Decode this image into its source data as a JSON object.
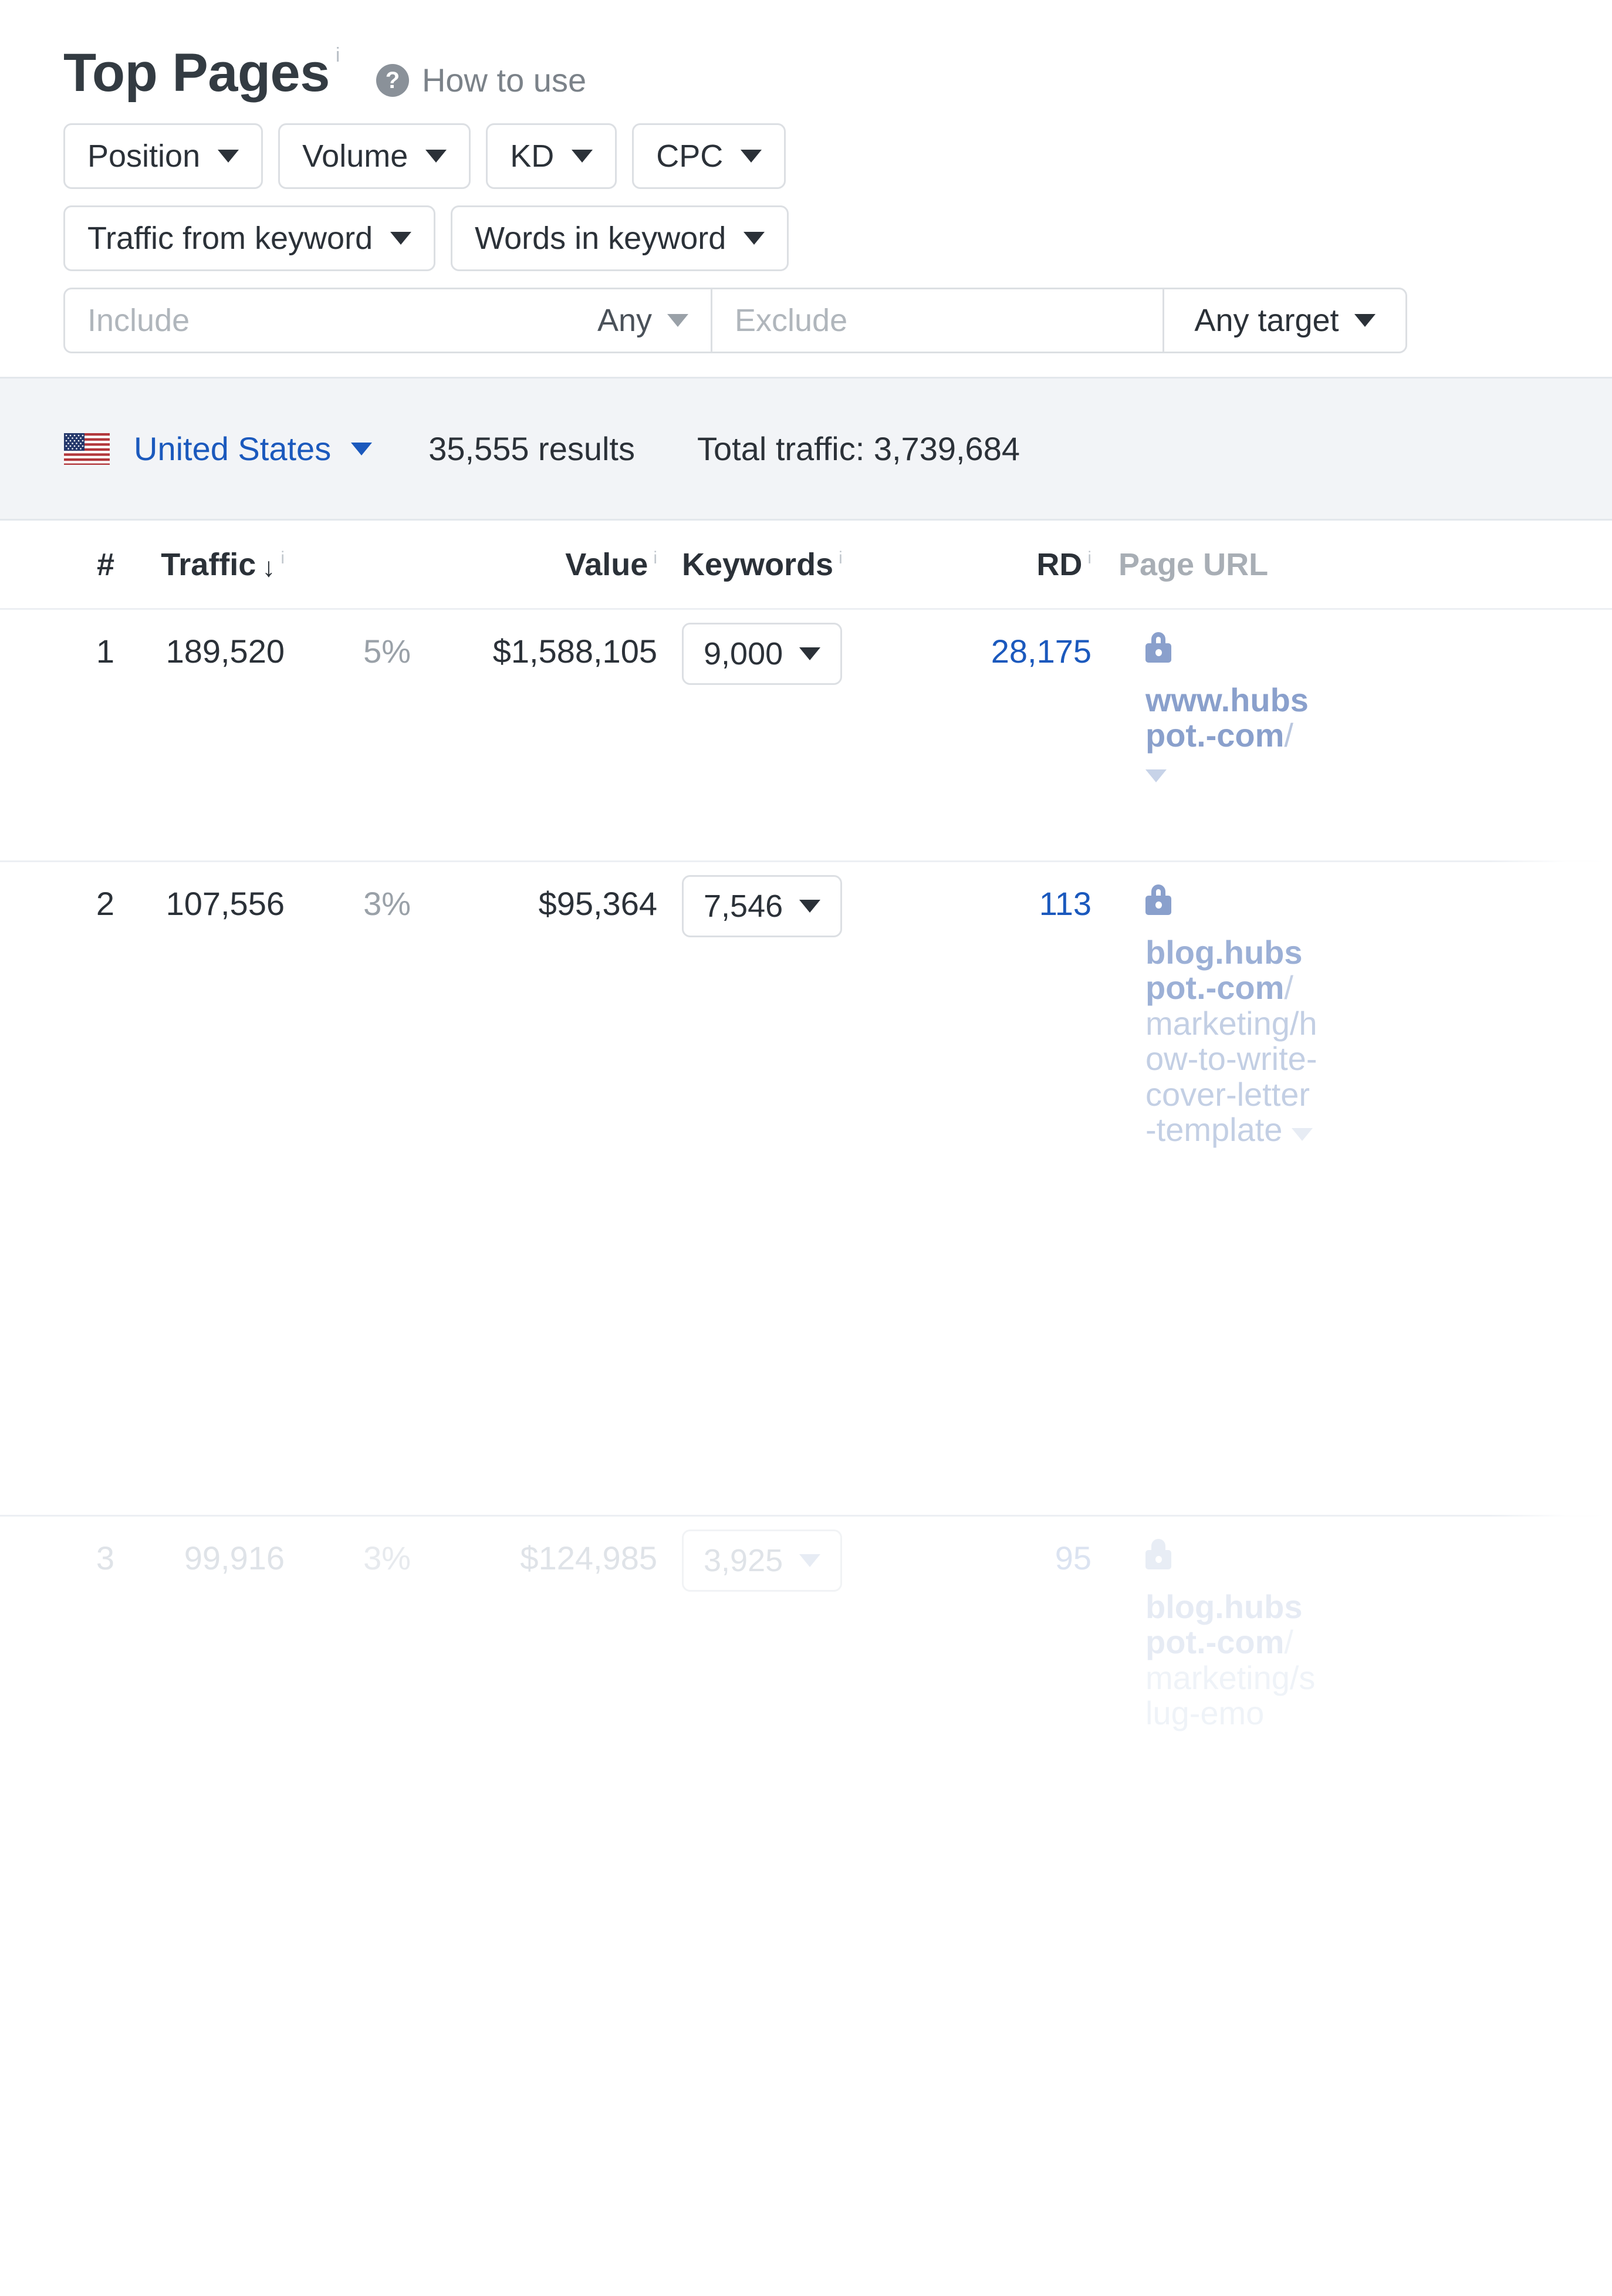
{
  "header": {
    "title": "Top Pages",
    "title_info_sup": "i",
    "help_icon": "question-mark-circle-icon",
    "help_label": "How to use"
  },
  "filters": {
    "row1": [
      {
        "label": "Position"
      },
      {
        "label": "Volume"
      },
      {
        "label": "KD"
      },
      {
        "label": "CPC"
      }
    ],
    "row2": [
      {
        "label": "Traffic from keyword"
      },
      {
        "label": "Words in keyword"
      }
    ],
    "include_exclude": {
      "include_placeholder": "Include",
      "include_mode": "Any",
      "exclude_placeholder": "Exclude",
      "target": "Any target"
    }
  },
  "country_bar": {
    "flag_icon": "us-flag-icon",
    "country": "United States",
    "results": "35,555 results",
    "total_traffic": "Total traffic: 3,739,684"
  },
  "table": {
    "columns": [
      {
        "key": "rank",
        "label": "#",
        "info": "",
        "sorted": false
      },
      {
        "key": "traffic",
        "label": "Traffic",
        "info": "i",
        "sorted": true,
        "sort_arrow": "↓"
      },
      {
        "key": "pct",
        "label": "",
        "info": "",
        "sorted": false
      },
      {
        "key": "value",
        "label": "Value",
        "info": "i",
        "sorted": false
      },
      {
        "key": "keywords",
        "label": "Keywords",
        "info": "i",
        "sorted": false
      },
      {
        "key": "rd",
        "label": "RD",
        "info": "i",
        "sorted": false
      },
      {
        "key": "url",
        "label": "Page URL",
        "info": "",
        "sorted": false
      }
    ],
    "rows": [
      {
        "rank": "1",
        "traffic": "189,520",
        "pct": "5%",
        "value": "$1,588,105",
        "keywords": "9,000",
        "rd": "28,175",
        "lock_icon": "lock-icon",
        "url_domain": "www.hubspot.-com",
        "url_path": "/"
      },
      {
        "rank": "2",
        "traffic": "107,556",
        "pct": "3%",
        "value": "$95,364",
        "keywords": "7,546",
        "rd": "113",
        "lock_icon": "lock-icon",
        "url_domain": "blog.hubspot.-com",
        "url_path": "/marketing/how-to-write-cover-letter-template"
      },
      {
        "rank": "3",
        "traffic": "99,916",
        "pct": "3%",
        "value": "$124,985",
        "keywords": "3,925",
        "rd": "95",
        "lock_icon": "lock-icon",
        "url_domain": "blog.hubspot.-com",
        "url_path": "/marketing/slug-emo"
      }
    ]
  },
  "colors": {
    "link_blue": "#1b59bd",
    "text_dark": "#2b3138",
    "muted": "#9aa1a8",
    "bar_bg": "#f2f4f7",
    "url_blue": "#8aa0cc"
  }
}
